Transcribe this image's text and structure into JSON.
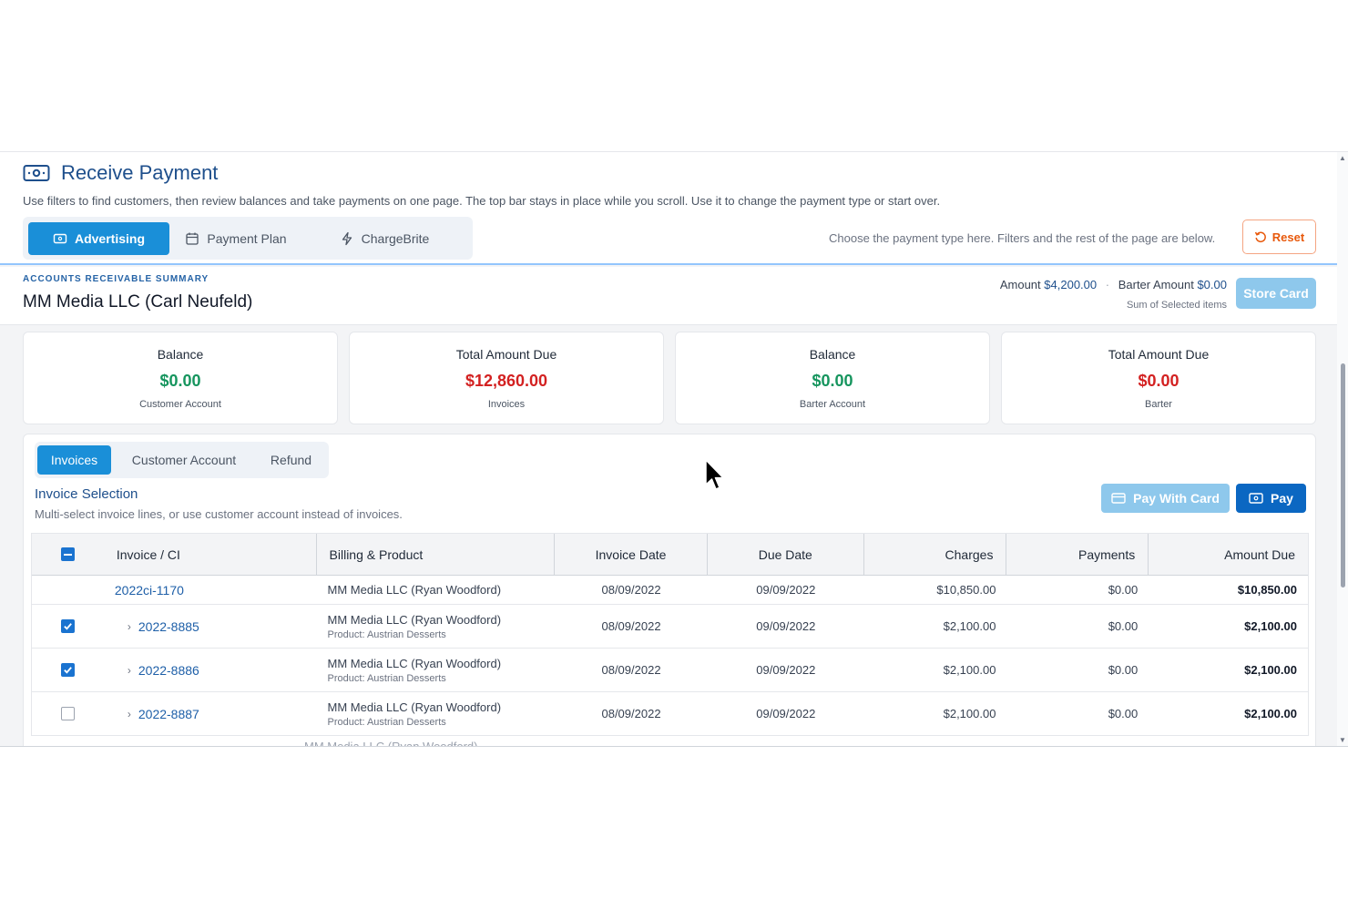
{
  "header": {
    "title": "Receive Payment",
    "subtitle": "Use filters to find customers, then review balances and take payments on one page. The top bar stays in place while you scroll. Use it to change the payment type or start over.",
    "payment_types": [
      {
        "label": "Advertising",
        "icon": "card-icon",
        "active": true
      },
      {
        "label": "Payment Plan",
        "icon": "calendar-icon",
        "active": false
      },
      {
        "label": "ChargeBrite",
        "icon": "bolt-icon",
        "active": false
      }
    ],
    "type_hint": "Choose the payment type here. Filters and the rest of the page are below.",
    "reset_label": "Reset"
  },
  "summary": {
    "label": "ACCOUNTS RECEIVABLE SUMMARY",
    "customer": "MM Media LLC (Carl Neufeld)",
    "amount_label": "Amount",
    "amount_value": "$4,200.00",
    "barter_label": "Barter Amount",
    "barter_value": "$0.00",
    "sub_label": "Sum of Selected items",
    "store_card_label": "Store Card"
  },
  "cards": [
    {
      "title": "Balance",
      "value": "$0.00",
      "sub": "Customer Account",
      "tone": "green"
    },
    {
      "title": "Total Amount Due",
      "value": "$12,860.00",
      "sub": "Invoices",
      "tone": "red"
    },
    {
      "title": "Balance",
      "value": "$0.00",
      "sub": "Barter Account",
      "tone": "green"
    },
    {
      "title": "Total Amount Due",
      "value": "$0.00",
      "sub": "Barter",
      "tone": "red"
    }
  ],
  "panel": {
    "tabs": [
      {
        "label": "Invoices",
        "active": true
      },
      {
        "label": "Customer Account",
        "active": false
      },
      {
        "label": "Refund",
        "active": false
      }
    ],
    "selection_title": "Invoice Selection",
    "selection_sub": "Multi-select invoice lines, or use customer account instead of invoices.",
    "pay_with_card_label": "Pay With Card",
    "pay_label": "Pay"
  },
  "table": {
    "columns": [
      "Invoice / CI",
      "Billing & Product",
      "Invoice Date",
      "Due Date",
      "Charges",
      "Payments",
      "Amount Due"
    ],
    "rows": [
      {
        "invoice": "2022ci-1170",
        "billing": "MM Media LLC (Ryan Woodford)",
        "product": "",
        "invoice_date": "08/09/2022",
        "due_date": "09/09/2022",
        "charges": "$10,850.00",
        "payments": "$0.00",
        "amount_due": "$10,850.00"
      },
      {
        "invoice": "2022-8885",
        "billing": "MM Media LLC (Ryan Woodford)",
        "product": "Product: Austrian Desserts",
        "invoice_date": "08/09/2022",
        "due_date": "09/09/2022",
        "charges": "$2,100.00",
        "payments": "$0.00",
        "amount_due": "$2,100.00"
      },
      {
        "invoice": "2022-8886",
        "billing": "MM Media LLC (Ryan Woodford)",
        "product": "Product: Austrian Desserts",
        "invoice_date": "08/09/2022",
        "due_date": "09/09/2022",
        "charges": "$2,100.00",
        "payments": "$0.00",
        "amount_due": "$2,100.00"
      },
      {
        "invoice": "2022-8887",
        "billing": "MM Media LLC (Ryan Woodford)",
        "product": "Product: Austrian Desserts",
        "invoice_date": "08/09/2022",
        "due_date": "09/09/2022",
        "charges": "$2,100.00",
        "payments": "$0.00",
        "amount_due": "$2,100.00"
      }
    ],
    "partial_row_text": "MM Media LLC (Ryan Woodford)"
  },
  "colors": {
    "accent": "#1a8fd8",
    "primary_dark": "#0b67c2",
    "positive": "#16955e",
    "negative": "#d32121",
    "reset": "#e8590c"
  }
}
